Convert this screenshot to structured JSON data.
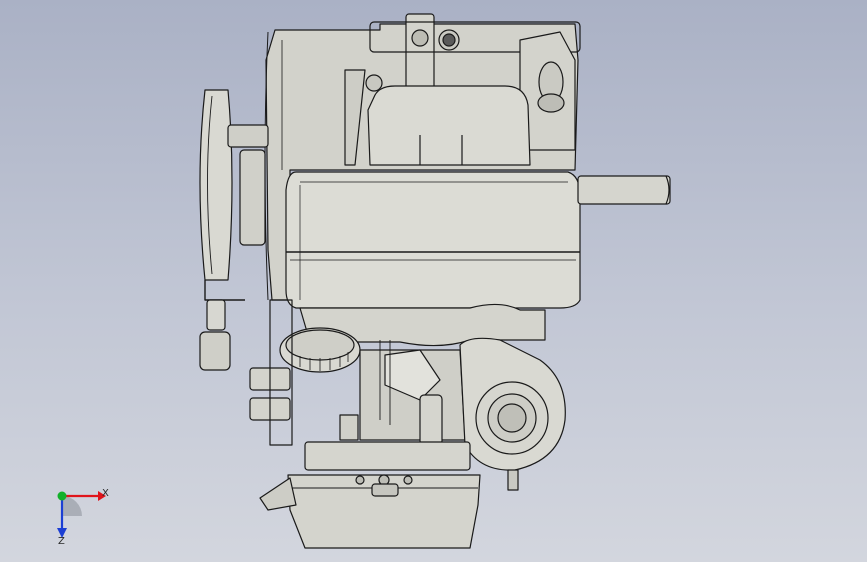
{
  "viewport": {
    "background_top": "#aab1c5",
    "background_bottom": "#d3d6de",
    "model_fill": "#d7d7d1",
    "model_stroke": "#1a1a1a"
  },
  "triad": {
    "x_label": "X",
    "z_label": "Z",
    "x_color": "#e0141b",
    "y_color": "#12b02a",
    "z_color": "#1c3fd4"
  }
}
